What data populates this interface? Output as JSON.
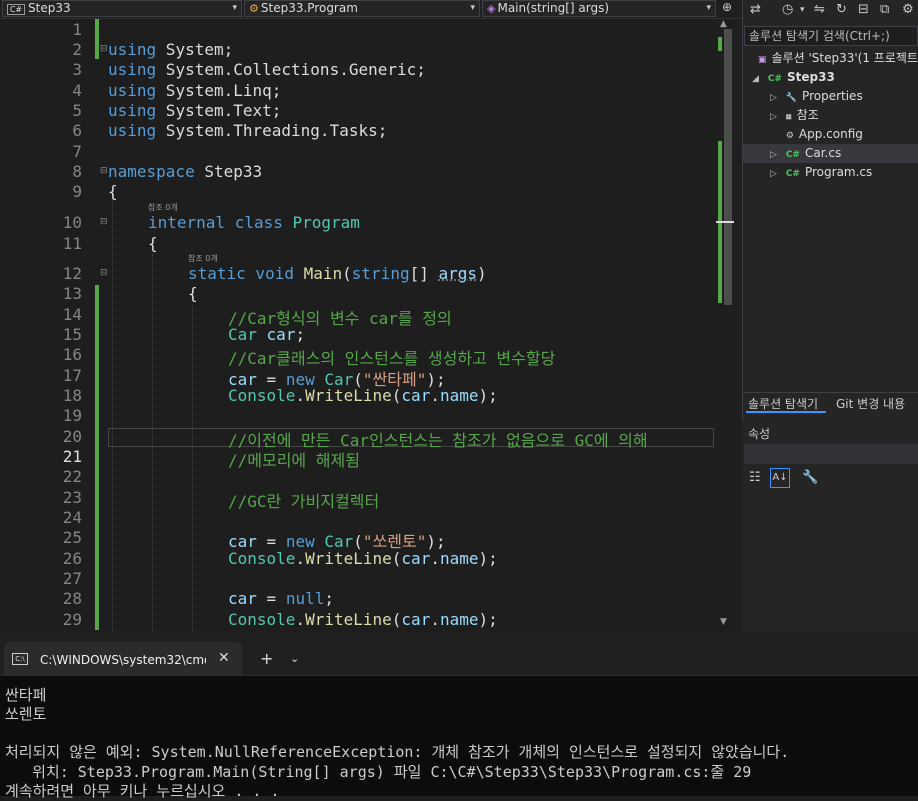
{
  "navbar": {
    "project": "Step33",
    "class": "Step33.Program",
    "member": "Main(string[] args)"
  },
  "editor": {
    "line_numbers": [
      "1",
      "2",
      "3",
      "4",
      "5",
      "6",
      "7",
      "8",
      "9",
      "10",
      "11",
      "12",
      "13",
      "14",
      "15",
      "16",
      "17",
      "18",
      "19",
      "20",
      "21",
      "22",
      "23",
      "24",
      "25",
      "26",
      "27",
      "28",
      "29"
    ],
    "current_line": "21",
    "ref_hint": "참조 0개",
    "code": {
      "l2_kw": "using",
      "l2_rest": " System;",
      "l3_kw": "using",
      "l3_rest": " System.Collections.Generic;",
      "l4_kw": "using",
      "l4_rest": " System.Linq;",
      "l5_kw": "using",
      "l5_rest": " System.Text;",
      "l6_kw": "using",
      "l6_rest": " System.Threading.Tasks;",
      "l8_kw": "namespace",
      "l8_rest": " Step33",
      "l9": "{",
      "l10_kw": "internal class",
      "l10_ty": "Program",
      "l11": "{",
      "l12_kw": "static void",
      "l12_fn": "Main",
      "l12_p1": "(",
      "l12_kw2": "string",
      "l12_p2": "[] ",
      "l12_va": "args",
      "l12_p3": ")",
      "l13": "{",
      "l14": "//Car형식의 변수 car를 정의",
      "l15_ty": "Car",
      "l15_va": "car",
      "l15_p": ";",
      "l16": "//Car클래스의 인스턴스를 생성하고 변수할당",
      "l17_va": "car",
      "l17_op": " = ",
      "l17_kw": "new",
      "l17_ty": "Car",
      "l17_p1": "(",
      "l17_st": "\"싼타페\"",
      "l17_p2": ");",
      "l18_ty": "Console",
      "l18_d": ".",
      "l18_fn": "WriteLine",
      "l18_p1": "(",
      "l18_va": "car",
      "l18_d2": ".",
      "l18_va2": "name",
      "l18_p2": ");",
      "l20": "//이전에 만든 Car인스턴스는 참조가 없음으로 GC에 의해",
      "l21": "//메모리에 해제됨",
      "l23": "//GC란 가비지컬렉터",
      "l25_va": "car",
      "l25_op": " = ",
      "l25_kw": "new",
      "l25_ty": "Car",
      "l25_p1": "(",
      "l25_st": "\"쏘렌토\"",
      "l25_p2": ");",
      "l26_ty": "Console",
      "l26_d": ".",
      "l26_fn": "WriteLine",
      "l26_p1": "(",
      "l26_va": "car",
      "l26_d2": ".",
      "l26_va2": "name",
      "l26_p2": ");",
      "l28_va": "car",
      "l28_op": " = ",
      "l28_kw": "null",
      "l28_p": ";",
      "l29_ty": "Console",
      "l29_d": ".",
      "l29_fn": "WriteLine",
      "l29_p1": "(",
      "l29_va": "car",
      "l29_d2": ".",
      "l29_va2": "name",
      "l29_p2": ");"
    }
  },
  "solution_explorer": {
    "search_placeholder": "솔루션 탐색기 검색(Ctrl+;)",
    "items": [
      {
        "label": "솔루션 'Step33'(1 프로젝트"
      },
      {
        "label": "Step33"
      },
      {
        "label": "Properties"
      },
      {
        "label": "참조"
      },
      {
        "label": "App.config"
      },
      {
        "label": "Car.cs"
      },
      {
        "label": "Program.cs"
      }
    ],
    "tabs": [
      "솔루션 탐색기",
      "Git 변경 내용"
    ],
    "properties_title": "속성"
  },
  "terminal": {
    "tab_title": "C:\\WINDOWS\\system32\\cmd",
    "lines": [
      "싼타페",
      "쏘렌토",
      "",
      "처리되지 않은 예외: System.NullReferenceException: 개체 참조가 개체의 인스턴스로 설정되지 않았습니다.",
      "   위치: Step33.Program.Main(String[] args) 파일 C:\\C#\\Step33\\Step33\\Program.cs:줄 29",
      "계속하려면 아무 키나 누르십시오 . . ."
    ]
  }
}
